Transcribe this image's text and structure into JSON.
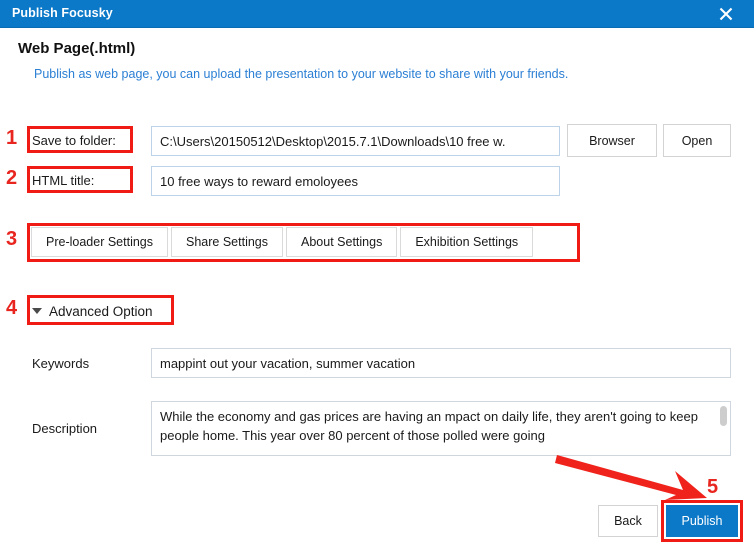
{
  "window": {
    "title": "Publish Focusky",
    "close_icon": "close-icon",
    "titlebar_color": "#0b78c8"
  },
  "header": {
    "heading": "Web Page(.html)",
    "subheading": "Publish as web page, you can upload the presentation to your website to share with your friends.",
    "subheading_color": "#2b7fd4"
  },
  "form": {
    "save_to_folder": {
      "label": "Save to folder:",
      "value": "C:\\Users\\20150512\\Desktop\\2015.7.1\\Downloads\\10 free w.",
      "placeholder": "Choose output folder",
      "browse_button": "Browser",
      "open_button": "Open"
    },
    "html_title": {
      "label": "HTML title:",
      "value": "10 free ways to reward emoloyees",
      "placeholder": "Enter HTML title"
    },
    "keywords": {
      "label": "Keywords",
      "value": "mappint out your vacation, summer vacation",
      "placeholder": "Enter keywords"
    },
    "description": {
      "label": "Description",
      "value": "While the economy and gas prices are having an mpact on daily life, they aren't going to keep people home. This year over 80 percent of those polled were going",
      "placeholder": "Enter description"
    }
  },
  "tabs": [
    {
      "label": "Pre-loader Settings"
    },
    {
      "label": "Share Settings"
    },
    {
      "label": "About Settings"
    },
    {
      "label": "Exhibition Settings"
    }
  ],
  "advanced": {
    "label": "Advanced Option",
    "caret_icon": "chevron-down-icon",
    "expanded": true
  },
  "footer": {
    "back_button": "Back",
    "publish_button": "Publish",
    "publish_color": "#0b78c8"
  },
  "annotations": {
    "color": "#f01b15",
    "numbers": [
      "1",
      "2",
      "3",
      "4",
      "5"
    ],
    "arrow_icon": "arrow-pointer-icon"
  }
}
